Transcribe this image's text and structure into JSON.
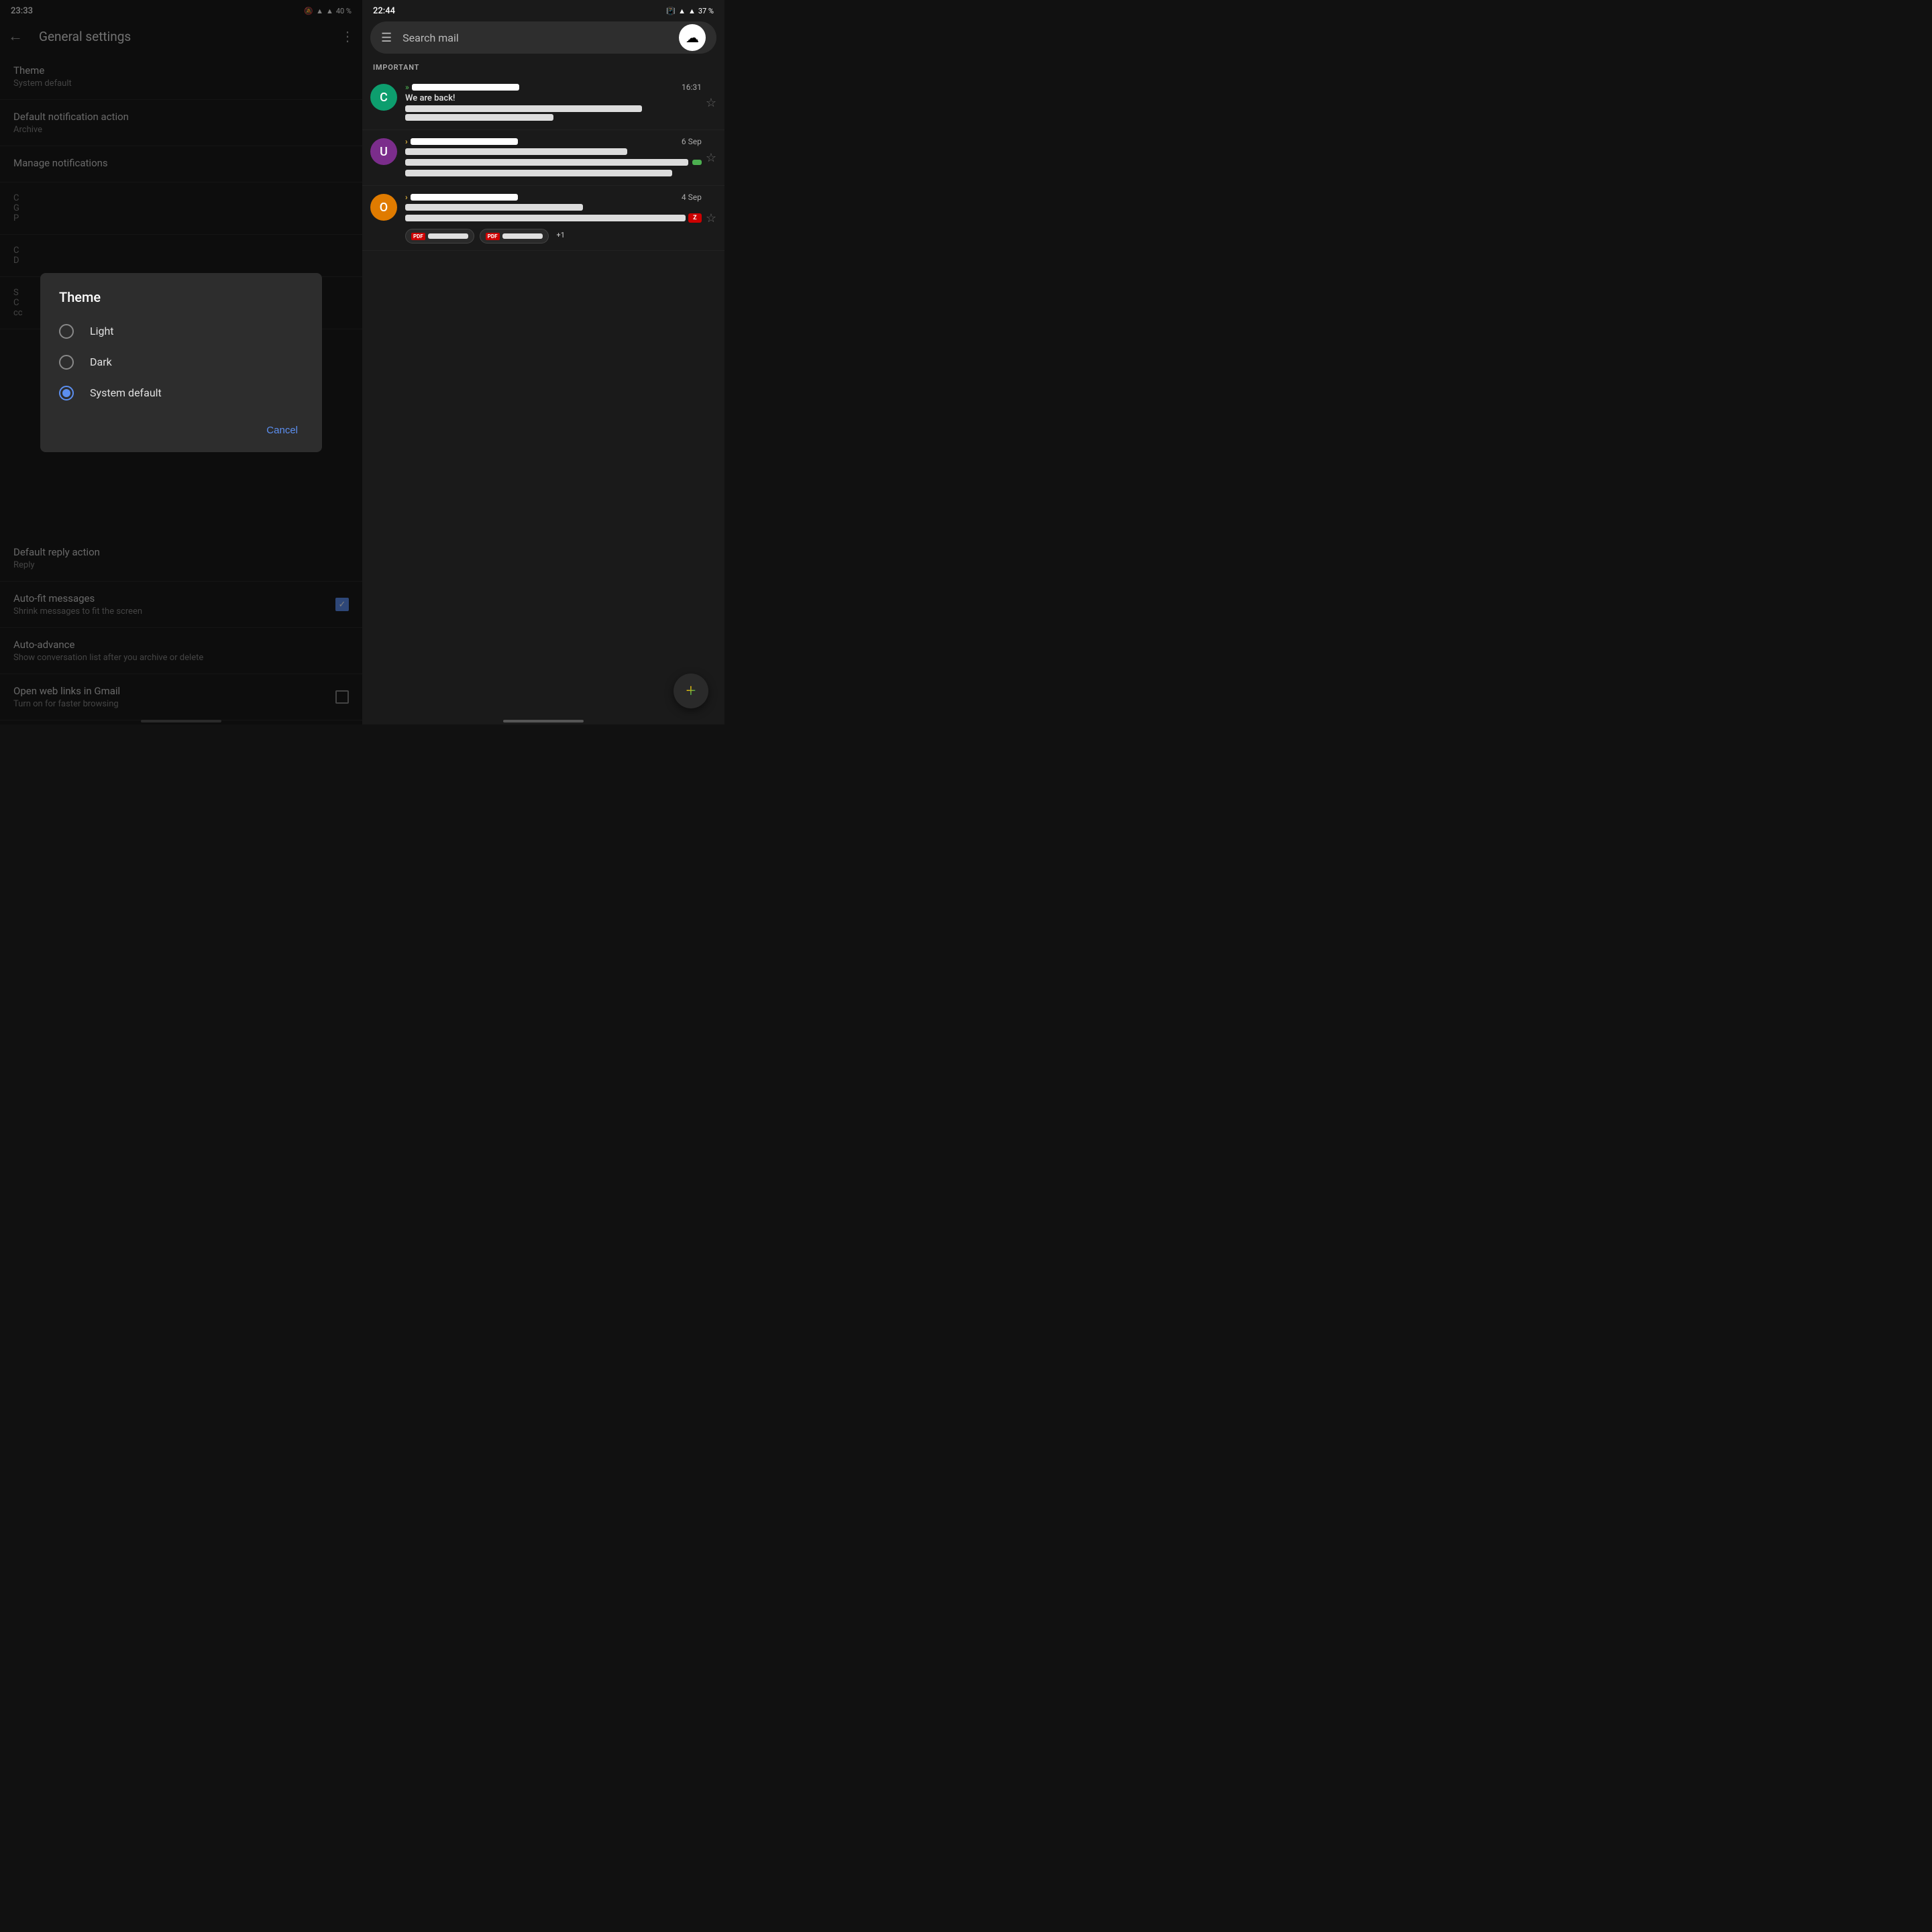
{
  "left": {
    "status_bar": {
      "time": "23:33",
      "battery": "40 %"
    },
    "header": {
      "title": "General settings",
      "back_label": "←",
      "more_label": "⋮"
    },
    "settings": [
      {
        "title": "Theme",
        "subtitle": "System default"
      },
      {
        "title": "Default notification action",
        "subtitle": "Archive"
      },
      {
        "title": "Manage notifications",
        "subtitle": ""
      },
      {
        "title": "C",
        "subtitle": "G\nP"
      },
      {
        "title": "C",
        "subtitle": "D"
      },
      {
        "title": "S",
        "subtitle": "C\ncc"
      },
      {
        "title": "Default reply action",
        "subtitle": "Reply"
      },
      {
        "title": "Auto-fit messages",
        "subtitle": "Shrink messages to fit the screen",
        "checkbox": true
      },
      {
        "title": "Auto-advance",
        "subtitle": "Show conversation list after you archive or delete"
      },
      {
        "title": "Open web links in Gmail",
        "subtitle": "Turn on for faster browsing",
        "checkbox_empty": true
      }
    ],
    "dialog": {
      "title": "Theme",
      "options": [
        {
          "label": "Light",
          "selected": false
        },
        {
          "label": "Dark",
          "selected": false
        },
        {
          "label": "System default",
          "selected": true
        }
      ],
      "cancel_label": "Cancel"
    }
  },
  "right": {
    "status_bar": {
      "time": "22:44",
      "battery": "37 %"
    },
    "search": {
      "placeholder": "Search mail"
    },
    "section": "IMPORTANT",
    "emails": [
      {
        "avatar_letter": "C",
        "avatar_color": "#0d9e6e",
        "sender_redacted": true,
        "time": "16:31",
        "subject": "We are back!",
        "preview_redacted": true,
        "arrow": "»",
        "arrow_color": "#4caf50",
        "star": true
      },
      {
        "avatar_letter": "U",
        "avatar_color": "#7b2d8b",
        "sender_redacted": true,
        "time": "6 Sep",
        "subject_redacted": true,
        "preview_redacted": true,
        "arrow": "›",
        "arrow_color": "#f0c040",
        "star": true,
        "has_green_tag": true
      },
      {
        "avatar_letter": "O",
        "avatar_color": "#e07b00",
        "sender_redacted": true,
        "time": "4 Sep",
        "subject_redacted": true,
        "preview_redacted": true,
        "arrow": "›",
        "arrow_color": "#f0c040",
        "star": true,
        "has_attachments": true
      }
    ]
  }
}
